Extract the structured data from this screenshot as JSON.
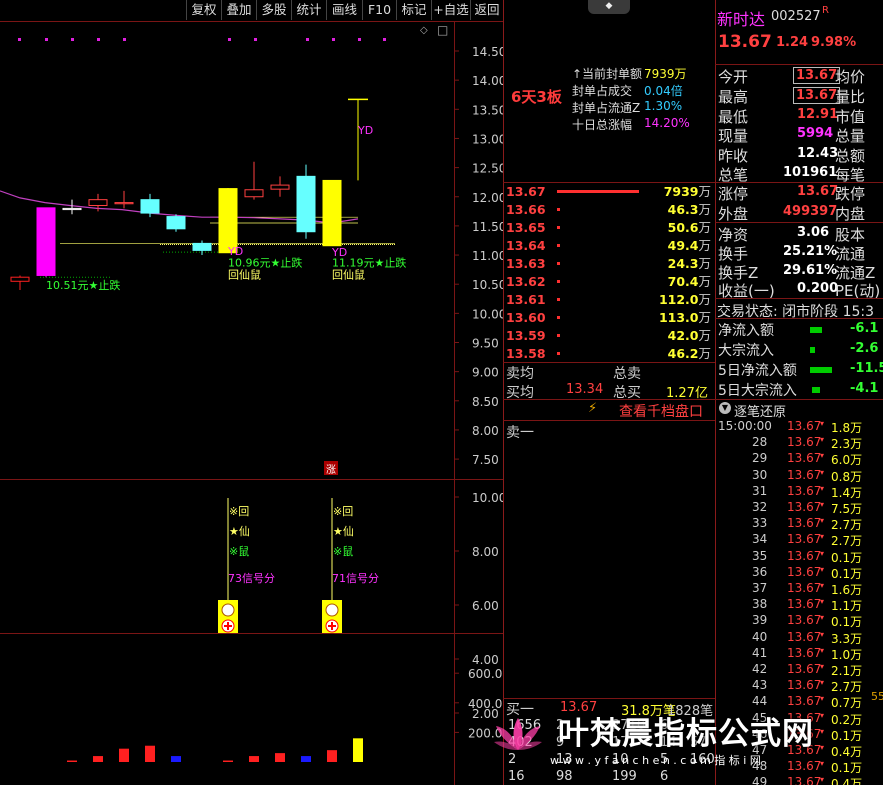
{
  "toolbar": [
    "复权",
    "叠加",
    "多股",
    "统计",
    "画线",
    "F10",
    "标记",
    "+自选",
    "返回"
  ],
  "chart_data": [
    {
      "type": "candlestick",
      "title": "",
      "ylim": [
        7.5,
        14.5
      ],
      "y_ticks": [
        "14.50",
        "14.00",
        "13.50",
        "13.00",
        "12.50",
        "12.00",
        "11.50",
        "11.00",
        "10.50",
        "10.00",
        "9.50",
        "9.00",
        "8.50",
        "8.00",
        "7.50"
      ],
      "candles": [
        {
          "o": 10.55,
          "h": 10.65,
          "l": 10.4,
          "c": 10.62
        },
        {
          "o": 10.65,
          "h": 11.81,
          "l": 10.62,
          "c": 11.81
        },
        {
          "o": 11.78,
          "h": 11.95,
          "l": 11.7,
          "c": 11.8
        },
        {
          "o": 11.85,
          "h": 12.05,
          "l": 11.75,
          "c": 11.95
        },
        {
          "o": 11.9,
          "h": 12.1,
          "l": 11.8,
          "c": 11.88
        },
        {
          "o": 11.72,
          "h": 12.05,
          "l": 11.65,
          "c": 11.95
        },
        {
          "o": 11.45,
          "h": 11.7,
          "l": 11.4,
          "c": 11.66
        },
        {
          "o": 11.08,
          "h": 11.25,
          "l": 11.0,
          "c": 11.2
        },
        {
          "o": 11.04,
          "h": 12.15,
          "l": 11.04,
          "c": 12.14
        },
        {
          "o": 12.0,
          "h": 12.6,
          "l": 11.95,
          "c": 12.12
        },
        {
          "o": 12.2,
          "h": 12.35,
          "l": 12.0,
          "c": 12.13
        },
        {
          "o": 11.4,
          "h": 12.55,
          "l": 11.28,
          "c": 12.35
        },
        {
          "o": 11.16,
          "h": 12.28,
          "l": 11.16,
          "c": 12.28
        },
        {
          "o": 12.28,
          "h": 13.67,
          "l": 12.28,
          "c": 13.67
        }
      ],
      "ma_line": [
        12.1,
        11.98,
        11.9,
        11.85,
        11.8,
        11.78,
        11.72,
        11.68,
        11.65,
        11.65,
        11.64,
        11.62,
        11.6,
        11.55,
        11.62
      ],
      "annotations": {
        "up_label": "涨",
        "stop_labels": [
          "10.51元★止跌",
          "10.96元★止跌",
          "11.19元★止跌"
        ],
        "yd_labels": [
          "YD",
          "YD",
          "YD"
        ],
        "pattern_labels": [
          "回仙鼠",
          "回仙鼠"
        ]
      }
    },
    {
      "type": "indicator",
      "y_ticks": [
        "10.00",
        "8.00",
        "6.00",
        "4.00",
        "2.00"
      ],
      "signals": [
        {
          "lines": [
            "※回",
            "★仙",
            "※鼠"
          ],
          "score": "73信号分"
        },
        {
          "lines": [
            "※回",
            "★仙",
            "※鼠"
          ],
          "score": "71信号分"
        }
      ]
    },
    {
      "type": "bar",
      "y_ticks": [
        "600.0",
        "400.0",
        "200.0"
      ],
      "values": [
        10,
        40,
        90,
        110,
        40,
        10,
        40,
        60,
        40,
        80,
        160
      ],
      "colors": [
        "#ff2020",
        "#ff2020",
        "#ff2020",
        "#ff2020",
        "#1a1aff",
        "#ff2020",
        "#ff2020",
        "#ff2020",
        "#1a1aff",
        "#ff2020",
        "#ffff00"
      ]
    }
  ],
  "mid": {
    "board_label": "6天3板",
    "seal": {
      "rows": [
        {
          "label": "↑当前封单额",
          "value": "7939万"
        },
        {
          "label": "封单占成交",
          "value": "0.04倍"
        },
        {
          "label": "封单占流通Z",
          "value": "1.30%"
        },
        {
          "label": "十日总涨幅",
          "value": "14.20%"
        }
      ]
    },
    "queue": [
      {
        "p": "13.67",
        "v": "7939",
        "u": "万",
        "bar": 82
      },
      {
        "p": "13.66",
        "v": "46.3",
        "u": "万",
        "bar": 3
      },
      {
        "p": "13.65",
        "v": "50.6",
        "u": "万",
        "bar": 3
      },
      {
        "p": "13.64",
        "v": "49.4",
        "u": "万",
        "bar": 3
      },
      {
        "p": "13.63",
        "v": "24.3",
        "u": "万",
        "bar": 3
      },
      {
        "p": "13.62",
        "v": "70.4",
        "u": "万",
        "bar": 3
      },
      {
        "p": "13.61",
        "v": "112.0",
        "u": "万",
        "bar": 3
      },
      {
        "p": "13.60",
        "v": "113.0",
        "u": "万",
        "bar": 3
      },
      {
        "p": "13.59",
        "v": "42.0",
        "u": "万",
        "bar": 3
      },
      {
        "p": "13.58",
        "v": "46.2",
        "u": "万",
        "bar": 3
      }
    ],
    "sell_avg_label": "卖均",
    "sell_total_label": "总卖",
    "buy_avg_label": "买均",
    "buy_avg_value": "13.34",
    "buy_total_label": "总买",
    "buy_total_value": "1.27亿",
    "depth_button": "查看千档盘口",
    "sell_one": "卖一",
    "buy_one": {
      "label": "买一",
      "price": "13.67",
      "vol": "31.8万笔",
      "count": "1828笔"
    },
    "buy_rows": [
      [
        "1656",
        "2",
        "2710",
        "6",
        ""
      ],
      [
        "402",
        "9",
        "17",
        "14",
        "57"
      ],
      [
        "2",
        "13",
        "10",
        "5",
        "160"
      ],
      [
        "16",
        "98",
        "199",
        "6",
        ""
      ]
    ]
  },
  "right": {
    "name": "新时达",
    "code": "002527",
    "r": "R",
    "price": "13.67",
    "change": "1.24",
    "pct": "9.98%",
    "stats": [
      {
        "l": "今开",
        "v": "13.67",
        "boxed": true,
        "vc": "#ff4040",
        "r": "均价"
      },
      {
        "l": "最高",
        "v": "13.67",
        "boxed": true,
        "vc": "#ff4040",
        "r": "量比"
      },
      {
        "l": "最低",
        "v": "12.91",
        "boxed": false,
        "vc": "#ff4040",
        "r": "市值"
      },
      {
        "l": "现量",
        "v": "5994",
        "boxed": false,
        "vc": "#ff33ff",
        "r": "总量"
      },
      {
        "l": "昨收",
        "v": "12.43",
        "boxed": false,
        "vc": "#ffffff",
        "r": "总额"
      },
      {
        "l": "总笔",
        "v": "101961",
        "boxed": false,
        "vc": "#ffffff",
        "r": "每笔"
      },
      {
        "l": "涨停",
        "v": "13.67",
        "boxed": false,
        "vc": "#ff4040",
        "r": "跌停"
      },
      {
        "l": "外盘",
        "v": "499397",
        "boxed": false,
        "vc": "#ff4040",
        "r": "内盘"
      },
      {
        "l": "净资",
        "v": "3.06",
        "boxed": false,
        "vc": "#ffffff",
        "r": "股本"
      },
      {
        "l": "换手",
        "v": "25.21%",
        "boxed": false,
        "vc": "#ffffff",
        "r": "流通"
      },
      {
        "l": "换手Z",
        "v": "29.61%",
        "boxed": false,
        "vc": "#ffffff",
        "r": "流通Z"
      },
      {
        "l": "收益(一)",
        "v": "0.200",
        "boxed": false,
        "vc": "#ffffff",
        "r": "PE(动)"
      }
    ],
    "trade_status": "交易状态: 闭市阶段 15:3",
    "flows": [
      {
        "l": "净流入额",
        "v": "-6.1",
        "bar": 12
      },
      {
        "l": "大宗流入",
        "v": "-2.6",
        "bar": 5
      },
      {
        "l": "5日净流入额",
        "v": "-11.5",
        "bar": 22
      },
      {
        "l": "5日大宗流入",
        "v": "-4.1",
        "bar": 8
      }
    ],
    "ticks_title": "逐笔还原",
    "ticks": [
      {
        "t": "15:00:00",
        "p": "13.67",
        "v": "1.8万"
      },
      {
        "t": "28",
        "p": "13.67",
        "v": "2.3万"
      },
      {
        "t": "29",
        "p": "13.67",
        "v": "6.0万"
      },
      {
        "t": "30",
        "p": "13.67",
        "v": "0.8万"
      },
      {
        "t": "31",
        "p": "13.67",
        "v": "1.4万"
      },
      {
        "t": "32",
        "p": "13.67",
        "v": "7.5万"
      },
      {
        "t": "33",
        "p": "13.67",
        "v": "2.7万"
      },
      {
        "t": "34",
        "p": "13.67",
        "v": "2.7万"
      },
      {
        "t": "35",
        "p": "13.67",
        "v": "0.1万"
      },
      {
        "t": "36",
        "p": "13.67",
        "v": "0.1万"
      },
      {
        "t": "37",
        "p": "13.67",
        "v": "1.6万"
      },
      {
        "t": "38",
        "p": "13.67",
        "v": "1.1万"
      },
      {
        "t": "39",
        "p": "13.67",
        "v": "0.1万"
      },
      {
        "t": "40",
        "p": "13.67",
        "v": "3.3万"
      },
      {
        "t": "41",
        "p": "13.67",
        "v": "1.0万"
      },
      {
        "t": "42",
        "p": "13.67",
        "v": "2.1万"
      },
      {
        "t": "43",
        "p": "13.67",
        "v": "2.7万"
      },
      {
        "t": "44",
        "p": "13.67",
        "v": "0.7万"
      },
      {
        "t": "45",
        "p": "13.67",
        "v": "0.2万"
      },
      {
        "t": "46",
        "p": "13.67",
        "v": "0.1万"
      },
      {
        "t": "47",
        "p": "13.67",
        "v": "0.4万"
      },
      {
        "t": "48",
        "p": "13.67",
        "v": "0.1万"
      },
      {
        "t": "49",
        "p": "13.67",
        "v": "0.4万"
      }
    ],
    "edge_num": "55"
  },
  "watermark": {
    "text": "叶梵晨指标公式网",
    "url": "w w w . y f a n c h e n . c o m   指 标 i 网"
  }
}
